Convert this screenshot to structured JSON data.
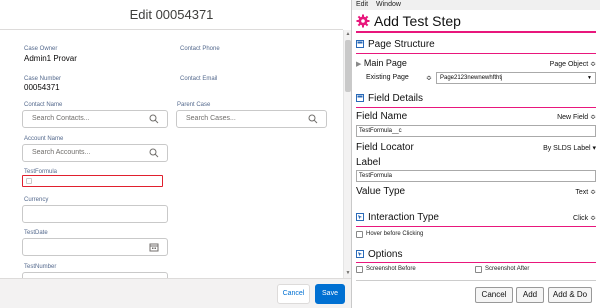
{
  "sf_modal": {
    "title": "Edit 00054371",
    "case_owner": {
      "label": "Case Owner",
      "value": "Admin1 Provar"
    },
    "contact_phone": {
      "label": "Contact Phone"
    },
    "case_number": {
      "label": "Case Number",
      "value": "00054371"
    },
    "contact_email": {
      "label": "Contact Email"
    },
    "contact_name": {
      "label": "Contact Name",
      "placeholder": "Search Contacts..."
    },
    "parent_case": {
      "label": "Parent Case",
      "placeholder": "Search Cases..."
    },
    "account_name": {
      "label": "Account Name",
      "placeholder": "Search Accounts..."
    },
    "test_formula": {
      "label": "TestFormula",
      "highlight_color": "#e0202e"
    },
    "currency": {
      "label": "Currency"
    },
    "test_date": {
      "label": "TestDate"
    },
    "test_number": {
      "label": "TestNumber"
    },
    "footer": {
      "cancel_label": "Cancel",
      "save_label": "Save"
    },
    "icons": [
      "search-icon",
      "calendar-icon"
    ]
  },
  "add_test_step": {
    "menu": [
      "Edit",
      "Window"
    ],
    "title": "Add Test Step",
    "accent_color": "#e8177c",
    "page_structure": {
      "heading": "Page Structure",
      "main_page_label": "Main Page",
      "main_page_value": "Page Object ≎",
      "existing_page_label": "Existing Page",
      "existing_page_value": "Page2123newnewhfthtj"
    },
    "field_details": {
      "heading": "Field Details",
      "field_name_label": "Field Name",
      "field_name_option": "New Field ≎",
      "field_name_value": "TestFormula__c",
      "field_locator_label": "Field Locator",
      "field_locator_value": "By SLDS Label ▾",
      "label_label": "Label",
      "label_value": "TestFormula",
      "value_type_label": "Value Type",
      "value_type_value": "Text ≎"
    },
    "interaction_type": {
      "heading": "Interaction Type",
      "value": "Click ≎",
      "hover_label": "Hover before Clicking"
    },
    "options": {
      "heading": "Options",
      "screenshot_before": "Screenshot Before",
      "screenshot_after": "Screenshot After"
    },
    "buttons": {
      "cancel": "Cancel",
      "add": "Add",
      "add_do": "Add & Do"
    }
  }
}
